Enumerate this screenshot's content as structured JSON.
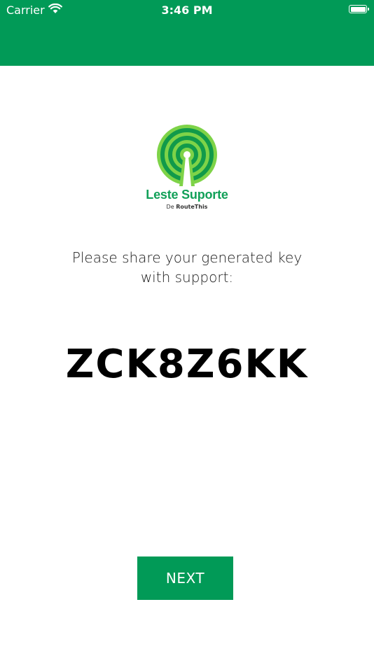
{
  "status_bar": {
    "carrier": "Carrier",
    "time": "3:46 PM"
  },
  "logo": {
    "name": "Leste Suporte",
    "byline_prefix": "De",
    "byline_brand": "RouteThis"
  },
  "instructions": {
    "line1": "Please share your generated key",
    "line2": "with support:"
  },
  "generated_key": "ZCK8Z6KK",
  "next_button": {
    "label": "NEXT"
  },
  "colors": {
    "header": "#019a57",
    "button": "#019a57",
    "logo_outer": "#7ed348",
    "logo_rings": "#119a4a",
    "brand_text": "#11a058"
  }
}
